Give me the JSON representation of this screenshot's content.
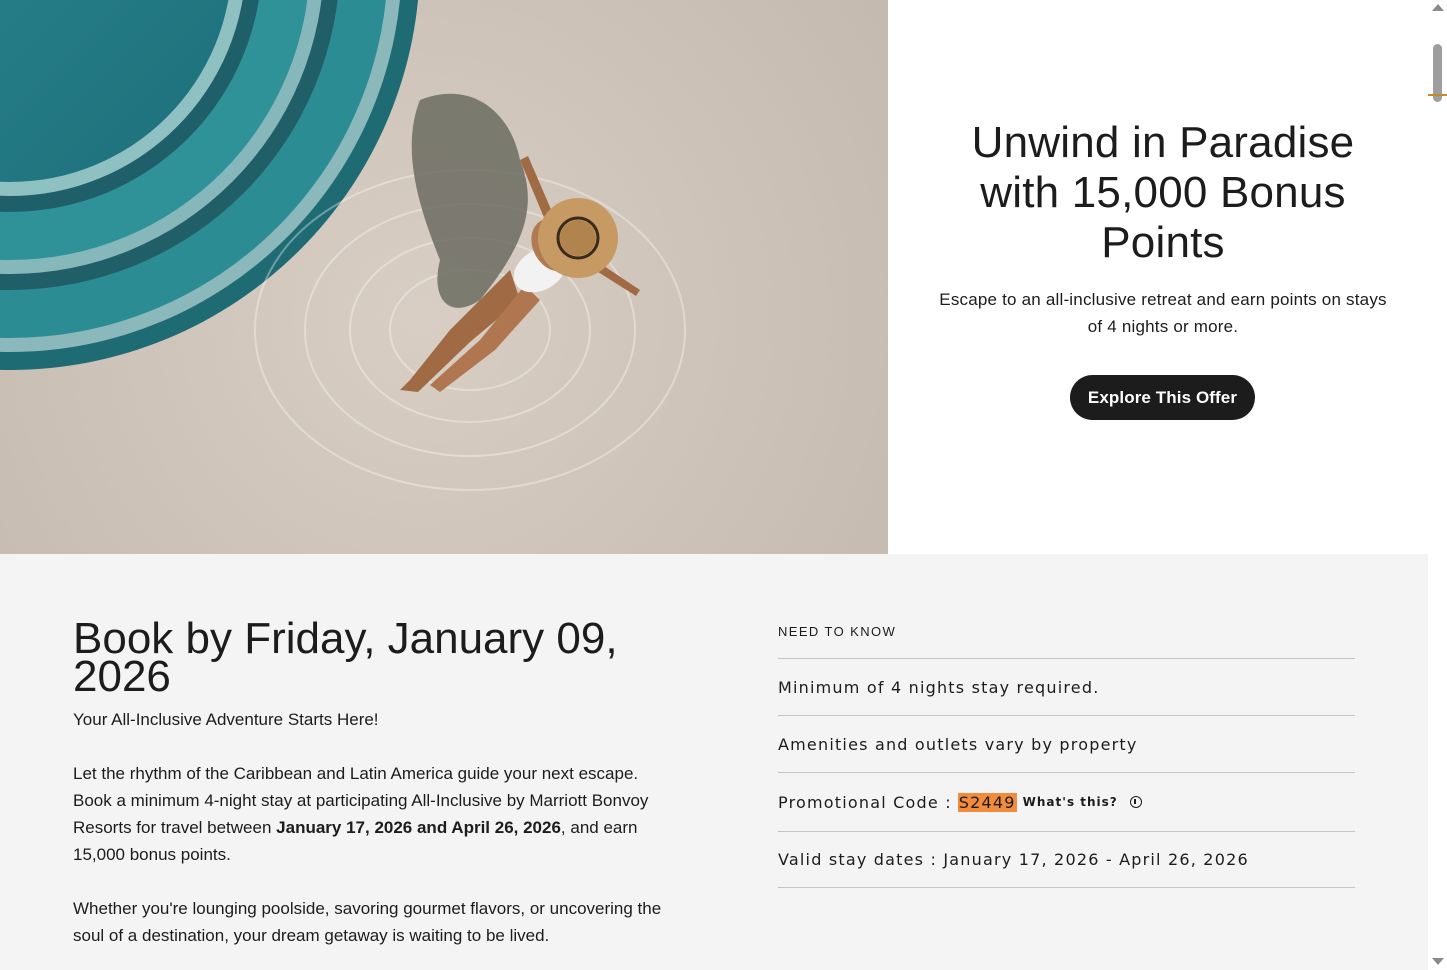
{
  "hero": {
    "image_alt": "Aerial view of a woman in a sun hat sitting in a shallow resort pool",
    "title": "Unwind in Paradise with 15,000 Bonus Points",
    "subtitle": "Escape to an all-inclusive retreat and earn points on stays of 4 nights or more.",
    "cta_label": "Explore This Offer"
  },
  "details": {
    "title": "Book by Friday, January 09, 2026",
    "subtitle": "Your All-Inclusive Adventure Starts Here!",
    "p1_part1": "Let the rhythm of the Caribbean and Latin America guide your next escape. Book a minimum 4-night stay at participating All-Inclusive by Marriott Bonvoy Resorts for travel between ",
    "p1_bold": "January 17, 2026 and April 26, 2026",
    "p1_part2": ", and earn 15,000 bonus points.",
    "p2": "Whether you're lounging poolside, savoring gourmet flavors, or uncovering the soul of a destination, your dream getaway is waiting to be lived."
  },
  "need_to_know": {
    "label": "NEED TO KNOW",
    "items": [
      "Minimum of 4 nights stay required.",
      "Amenities and outlets vary by property"
    ],
    "promo_label": "Promotional Code :",
    "promo_code": "S2449",
    "whats_this": "What's this?",
    "valid_dates": "Valid stay dates : January 17, 2026 - April 26, 2026"
  },
  "colors": {
    "text": "#1c1c1c",
    "button_bg": "#1c1c1c",
    "section_bg": "#f4f4f4",
    "promo_highlight": "#f28c3a",
    "pool_water": "#2a9fb4"
  }
}
